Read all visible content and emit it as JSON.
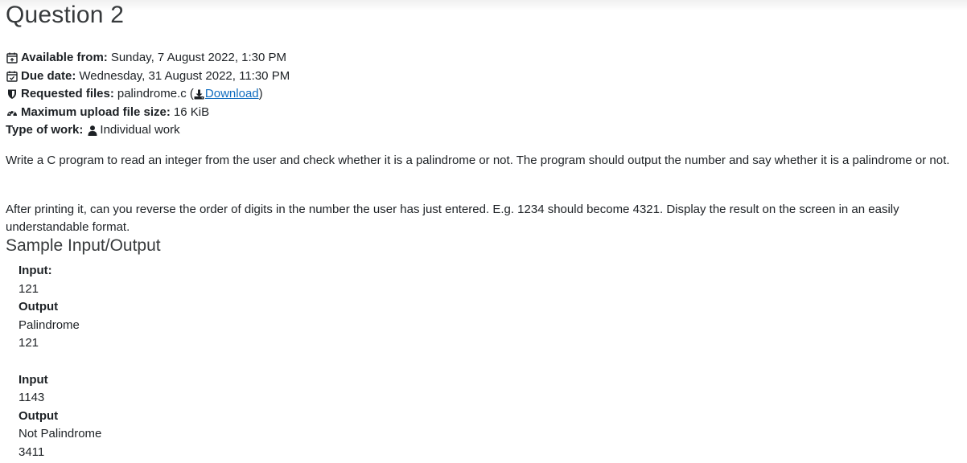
{
  "title": "Question 2",
  "meta": {
    "available_from": {
      "label": "Available from:",
      "value": "Sunday, 7 August 2022, 1:30 PM",
      "icon": "calendar-plus-icon"
    },
    "due_date": {
      "label": "Due date:",
      "value": "Wednesday, 31 August 2022, 11:30 PM",
      "icon": "calendar-check-icon"
    },
    "requested_files": {
      "label": "Requested files:",
      "value": "palindrome.c (",
      "link_text": "Download",
      "suffix": ")",
      "icon": "shield-icon",
      "link_icon": "download-icon"
    },
    "max_upload": {
      "label": "Maximum upload file size:",
      "value": "16 KiB",
      "icon": "dashboard-icon"
    },
    "type_of_work": {
      "label": "Type of work:",
      "value": "Individual work",
      "icon": "user-icon"
    }
  },
  "description": {
    "p1": "Write a C program to read an integer from the user and check whether it is a palindrome or not. The program should output the number and say whether it is a palindrome or not.",
    "p2": "After printing it, can you reverse the order of digits in the number the user has just entered. E.g. 1234 should become 4321. Display the result on the screen in an easily understandable format."
  },
  "sample_heading": "Sample Input/Output",
  "samples": [
    {
      "input_label": "Input:",
      "input": "121",
      "output_label": "Output",
      "output_lines": [
        "Palindrome",
        "121"
      ]
    },
    {
      "input_label": "Input",
      "input": "1143",
      "output_label": "Output",
      "output_lines": [
        "Not Palindrome",
        "3411"
      ]
    }
  ],
  "colors": {
    "link": "#0f6cbf",
    "text": "#1d2125",
    "heading": "#373a3c"
  }
}
